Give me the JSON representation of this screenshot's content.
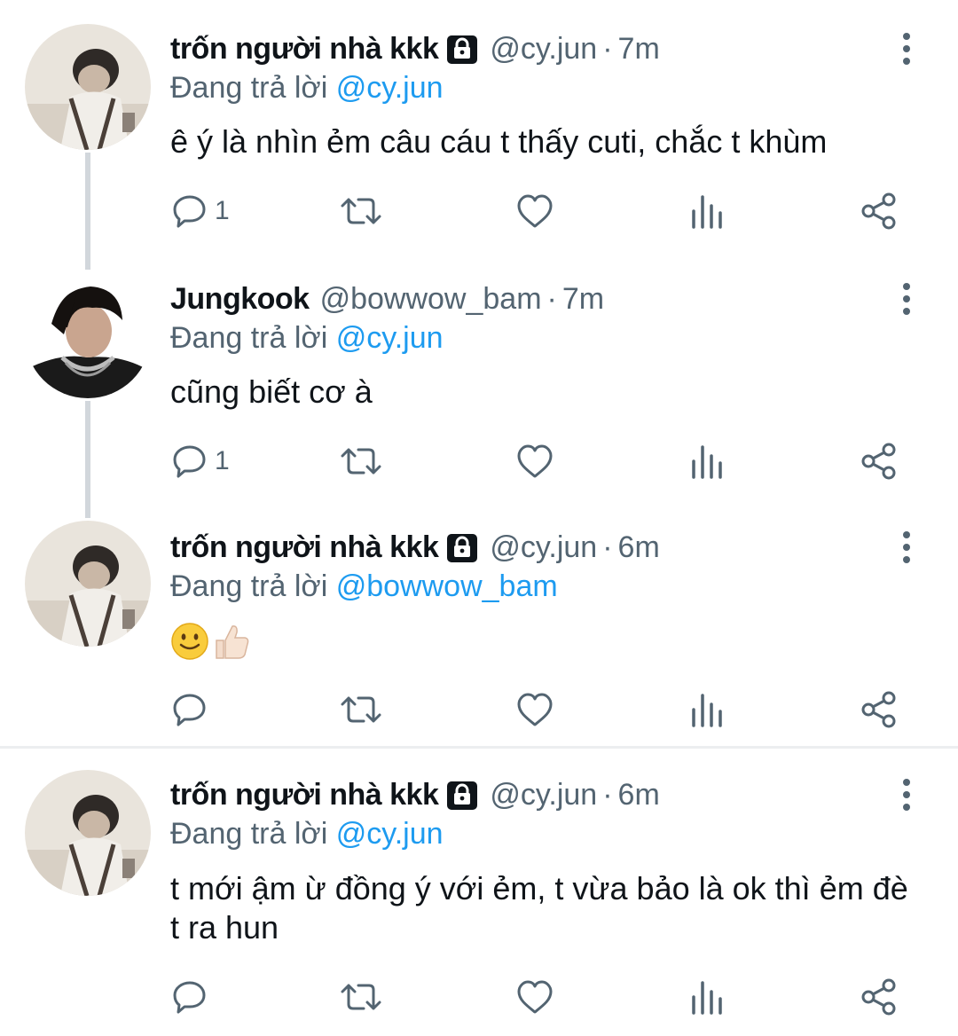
{
  "colors": {
    "link": "#1d9bf0",
    "secondary": "#536471",
    "text": "#0f1419",
    "thread_line": "#d2d7dc"
  },
  "icons": {
    "reply": "speech-bubble-icon",
    "retweet": "retweet-icon",
    "like": "heart-icon",
    "views": "bar-chart-icon",
    "share": "share-icon",
    "more": "vertical-dots-icon",
    "protected": "lock-icon"
  },
  "tweets": [
    {
      "display_name": "trốn người nhà kkk",
      "protected": true,
      "handle": "@cy.jun",
      "separator": "·",
      "time": "7m",
      "reply_prefix": "Đang trả lời",
      "reply_to": "@cy.jun",
      "text": "ê ý là nhìn ẻm câu cáu t thấy cuti, chắc t khùm",
      "reply_count": "1"
    },
    {
      "display_name": "Jungkook",
      "protected": false,
      "handle": "@bowwow_bam",
      "separator": "·",
      "time": "7m",
      "reply_prefix": "Đang trả lời",
      "reply_to": "@cy.jun",
      "text": "cũng biết cơ à",
      "reply_count": "1"
    },
    {
      "display_name": "trốn người nhà kkk",
      "protected": true,
      "handle": "@cy.jun",
      "separator": "·",
      "time": "6m",
      "reply_prefix": "Đang trả lời",
      "reply_to": "@bowwow_bam",
      "text": "🙂👍🏻",
      "reply_count": ""
    },
    {
      "display_name": "trốn người nhà kkk",
      "protected": true,
      "handle": "@cy.jun",
      "separator": "·",
      "time": "6m",
      "reply_prefix": "Đang trả lời",
      "reply_to": "@cy.jun",
      "text": "t mới ậm ừ đồng ý với ẻm, t vừa bảo là ok thì ẻm đè t ra hun",
      "reply_count": ""
    }
  ]
}
